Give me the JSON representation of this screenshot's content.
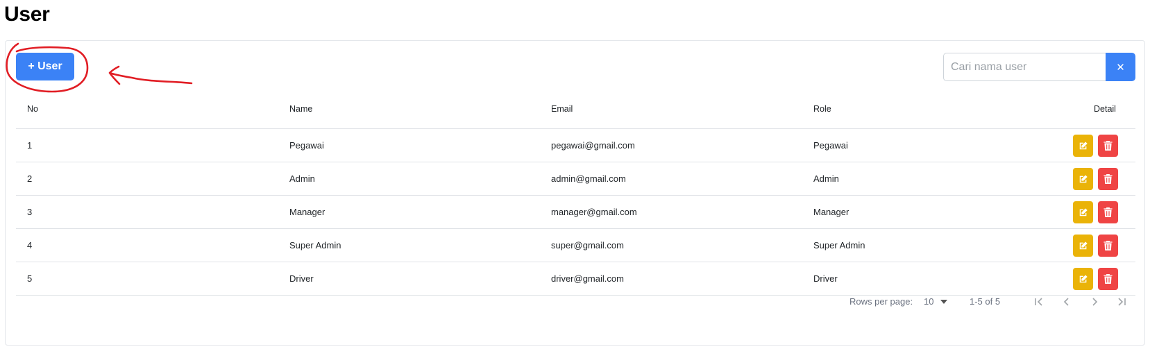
{
  "page": {
    "title": "User"
  },
  "toolbar": {
    "add_label": "+ User",
    "search_placeholder": "Cari nama user",
    "search_value": "",
    "clear_label": "✕"
  },
  "table": {
    "headers": {
      "no": "No",
      "name": "Name",
      "email": "Email",
      "role": "Role",
      "detail": "Detail"
    },
    "rows": [
      {
        "no": "1",
        "name": "Pegawai",
        "email": "pegawai@gmail.com",
        "role": "Pegawai"
      },
      {
        "no": "2",
        "name": "Admin",
        "email": "admin@gmail.com",
        "role": "Admin"
      },
      {
        "no": "3",
        "name": "Manager",
        "email": "manager@gmail.com",
        "role": "Manager"
      },
      {
        "no": "4",
        "name": "Super Admin",
        "email": "super@gmail.com",
        "role": "Super Admin"
      },
      {
        "no": "5",
        "name": "Driver",
        "email": "driver@gmail.com",
        "role": "Driver"
      }
    ]
  },
  "pagination": {
    "rows_per_page_label": "Rows per page:",
    "rows_per_page_value": "10",
    "range": "1-5 of 5"
  },
  "icons": {
    "edit": "edit-icon",
    "delete": "trash-icon",
    "first": "first-page-icon",
    "prev": "prev-page-icon",
    "next": "next-page-icon",
    "last": "last-page-icon"
  },
  "colors": {
    "primary": "#3b82f6",
    "edit": "#eab308",
    "delete": "#ef4444",
    "annotation": "#e11d24"
  }
}
